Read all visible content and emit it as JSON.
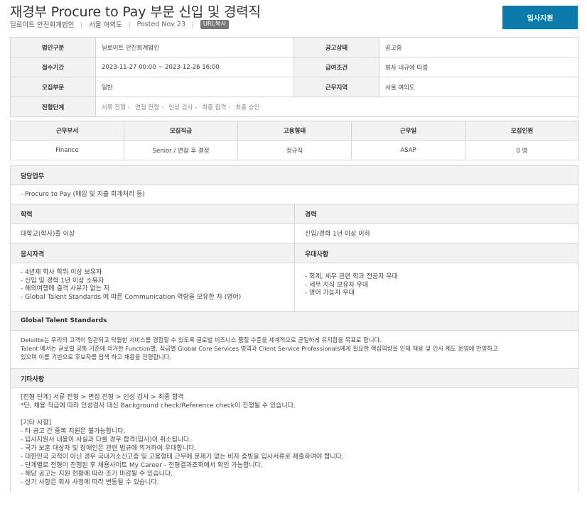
{
  "header": {
    "title": "재경부 Procure to Pay 부문 신입 및 경력직",
    "company": "딜로이트 안진회계법인",
    "location": "서울 여의도",
    "posted": "Posted Nov 23",
    "url_copy": "URL복사",
    "apply_label": "입사지원"
  },
  "info": {
    "corp_label": "법인구분",
    "corp_value": "딜로이트 안진회계법인",
    "status_label": "공고상태",
    "status_value": "공고중",
    "period_label": "접수기간",
    "period_value": "2023-11-27 00:00 ~ 2023-12-26 16:00",
    "salary_label": "급여조건",
    "salary_value": "회사 내규에 따름",
    "dept_label": "모집부문",
    "dept_value": "일반",
    "region_label": "근무지역",
    "region_value": "서울 여의도",
    "stages_label": "전형단계",
    "stages": [
      "서류 전형",
      "면접 전형",
      "인성 검사",
      "최종 합격",
      "최종 승인"
    ]
  },
  "positions": {
    "headers": [
      "근무부서",
      "모집직급",
      "고용형태",
      "근무일",
      "모집인원"
    ],
    "row": [
      "Finance",
      "Senior / 면접 후 결정",
      "정규직",
      "ASAP",
      "0 명"
    ]
  },
  "duty": {
    "title": "담당업무",
    "lines": [
      "- Procure to Pay (매입 및 지출 회계처리 등)"
    ]
  },
  "education": {
    "title": "학력",
    "value": "대학교(학사)졸 이상"
  },
  "career": {
    "title": "경력",
    "value": "신입/경력 1년 이상  이하"
  },
  "qualification": {
    "title": "응시자격",
    "lines": [
      "- 4년제 학사 학위 이상 보유자",
      "- 신입 및 경력 1년 이상 소유자",
      "- 해외여행에 결격 사유가 없는 자",
      "- Global Talent Standards 에 따른 Communication 역량을 보유한 자 (영어)"
    ]
  },
  "preference": {
    "title": "우대사항",
    "lines": [
      "- 회계, 세무 관련 학과 전공자 우대",
      "- 세무 지식 보유자 우대",
      "- 영어 가능자 우대"
    ]
  },
  "gts": {
    "title": "Global Talent Standards",
    "lines": [
      "Deloitte는 우리의 고객이 일관되고 탁월한 서비스를 경험할 수 있도록 글로벌 비즈니스 품질 수준을 세계적으로 균일하게 유지함을 목표로 합니다.",
      "Talent 에서는 글로벌 공통 기준에 의거한 Function별, 직급별 Global Core Services 영역과 Client Service Professionals에게 필요한 핵심역량을 인재 채용 및 인사 제도 운영에 반영하고",
      "있으며 이를 기반으로 후보자를 탐색 하고 채용을 진행합니다."
    ]
  },
  "etc": {
    "title": "기타사항",
    "lines": [
      "[전형 단계] 서류 전형 > 면접 전형 > 인성 검사 > 최종 합격",
      "*단, 채용 직급에 따라 인성검사 대신 Background check/Reference check이 진행될 수 있습니다.",
      "",
      "[기타 사항]",
      "- 타 공고 간 중복 지원은 불가능합니다.",
      "- 입사지원서 내용이 사실과 다를 경우 합격(입사)이 취소됩니다.",
      "- 국가 보훈 대상자 및 장애인은 관련 법규에 의거하여 우대합니다.",
      "- 대한민국 국적이 아닌 경우 국내거소신고증 및 고용형태 근무에 문제가 없는 비자 증빙을 입사서류로 제출하여야 합니다.",
      "- 단계별로 전형이 진행된 후 채용사이트 My Career - 전형결과조회에서 확인 가능합니다.",
      "- 해당 공고는 지원 현황에 따라 조기 마감될 수 있습니다.",
      "- 상기 사항은 회사 사정에 따라 변동될 수 있습니다."
    ]
  }
}
